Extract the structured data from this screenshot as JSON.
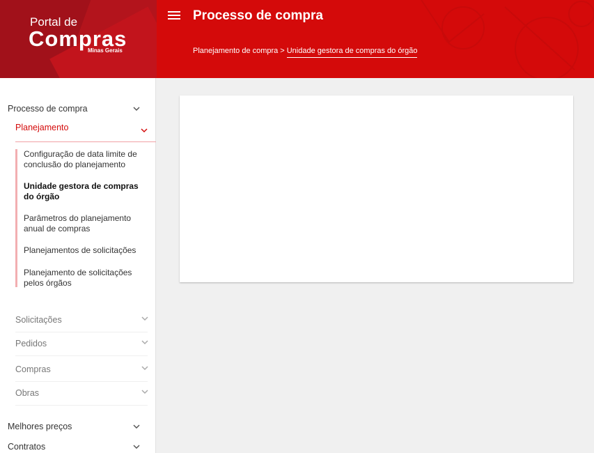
{
  "logo": {
    "line1": "Portal de",
    "line2": "Compras",
    "line3": "Minas Gerais"
  },
  "header": {
    "title": "Processo de compra",
    "breadcrumb": {
      "parent": "Planejamento de compra",
      "separator": ">",
      "current": "Unidade gestora de compras do órgão"
    }
  },
  "sidebar": {
    "processo": "Processo de compra",
    "planejamento": "Planejamento",
    "sub_items": [
      "Configuração de data limite de conclusão do planejamento",
      "Unidade gestora de compras do órgão",
      "Parâmetros do planejamento anual de compras",
      "Planejamentos de solicitações",
      "Planejamento de solicitações pelos órgãos"
    ],
    "sections": [
      "Solicitações",
      "Pedidos",
      "Compras",
      "Obras"
    ],
    "melhores_precos": "Melhores preços",
    "contratos": "Contratos"
  },
  "colors": {
    "brand_red": "#d40a0a",
    "logo_red": "#b3141c",
    "sub_border": "#f2aeb1"
  }
}
